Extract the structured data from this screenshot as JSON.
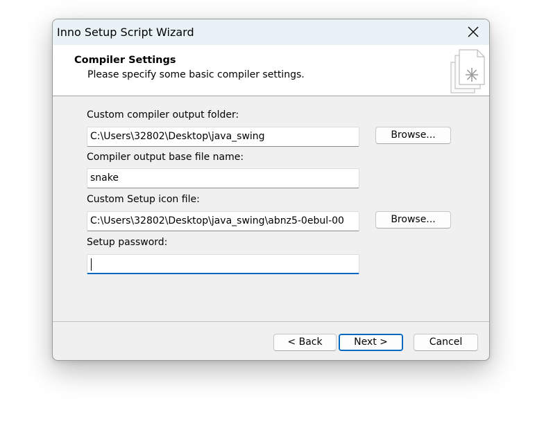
{
  "window": {
    "title": "Inno Setup Script Wizard"
  },
  "header": {
    "title": "Compiler Settings",
    "subtitle": "Please specify some basic compiler settings."
  },
  "form": {
    "output_folder_label": "Custom compiler output folder:",
    "output_folder_value": "C:\\Users\\32802\\Desktop\\java_swing",
    "output_folder_browse": "Browse...",
    "base_name_label": "Compiler output base file name:",
    "base_name_value": "snake",
    "icon_label": "Custom Setup icon file:",
    "icon_value": "C:\\Users\\32802\\Desktop\\java_swing\\abnz5-0ebul-00",
    "icon_browse": "Browse...",
    "password_label": "Setup password:",
    "password_value": ""
  },
  "footer": {
    "back_label": "< Back",
    "next_label": "Next >",
    "cancel_label": "Cancel"
  },
  "icons": {
    "close": "close-icon",
    "wizard": "wizard-document-icon"
  },
  "colors": {
    "title_bar": "#e9f3f7",
    "accent": "#0067c0",
    "dialog_bg": "#f0f0f0"
  }
}
